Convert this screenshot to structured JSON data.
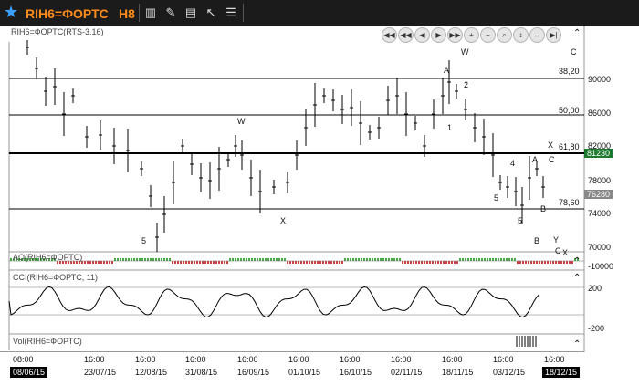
{
  "toolbar": {
    "symbol": "RIH6=ФОРТС",
    "timeframe": "H8",
    "icons": [
      "star-icon",
      "bar-chart-icon",
      "pencil-icon",
      "chart-type-icon",
      "cursor-icon",
      "indicator-list-icon"
    ]
  },
  "main_panel": {
    "label": "RIH6=ФОРТС(RTS-3.16)",
    "price_axis": [
      "90000",
      "86000",
      "82000",
      "78000",
      "74000",
      "70000"
    ],
    "current_price_tag": "81230",
    "second_price_tag": "76280",
    "fib_levels": [
      "38,20",
      "50,00",
      "61,80",
      "78,60"
    ],
    "wave_labels": [
      "W",
      "A",
      "2",
      "1",
      "5",
      "X",
      "4",
      "A",
      "C",
      "X",
      "5",
      "5",
      "B",
      "C",
      "B",
      "W",
      "C",
      "X",
      "Y"
    ]
  },
  "ao_panel": {
    "label": "AO(RIH6=ФОРТС)",
    "axis": "-10000"
  },
  "cci_panel": {
    "label": "CCI(RIH6=ФОРТС, 11)",
    "axis_top": "200",
    "axis_bottom": "-200"
  },
  "vol_panel": {
    "label": "Vol(RIH6=ФОРТС)"
  },
  "x_axis": {
    "times": [
      "08:00",
      "16:00",
      "16:00",
      "16:00",
      "16:00",
      "16:00",
      "16:00",
      "16:00",
      "16:00",
      "16:00",
      "16:00"
    ],
    "dates": [
      "08/06/15",
      "23/07/15",
      "12/08/15",
      "31/08/15",
      "16/09/15",
      "01/10/15",
      "16/10/15",
      "02/11/15",
      "18/11/15",
      "03/12/15",
      "18/12/15"
    ]
  },
  "nav_buttons": [
    "scroll-first",
    "scroll-left",
    "scroll-left-small",
    "scroll-right-small",
    "scroll-right",
    "scroll-last",
    "zoom-in",
    "zoom-out",
    "search",
    "fit-vertical",
    "fit-horizontal",
    "scroll-end"
  ],
  "colors": {
    "toolbar_bg": "#1b1b1b",
    "accent": "#ff8c1a",
    "current_price_bg": "#1c7a2e",
    "second_price_bg": "#888888"
  }
}
